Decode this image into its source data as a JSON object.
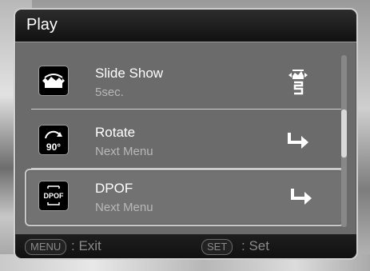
{
  "header": {
    "title": "Play"
  },
  "menu": {
    "items": [
      {
        "label": "Slide Show",
        "value": "5sec.",
        "icon": "slideshow-icon",
        "right_icon": "slideshow-interval-icon",
        "selected": false
      },
      {
        "label": "Rotate",
        "value": "Next Menu",
        "icon": "rotate-90-icon",
        "right_icon": "next-menu-arrow-icon",
        "selected": false
      },
      {
        "label": "DPOF",
        "value": "Next Menu",
        "icon": "dpof-icon",
        "right_icon": "next-menu-arrow-icon",
        "selected": true
      }
    ]
  },
  "footer": {
    "menu_button": "MENU",
    "menu_action": ": Exit",
    "set_button": "SET",
    "set_action": ": Set"
  },
  "icons": {
    "dpof_label": "DPOF",
    "rotate_label": "90°"
  }
}
